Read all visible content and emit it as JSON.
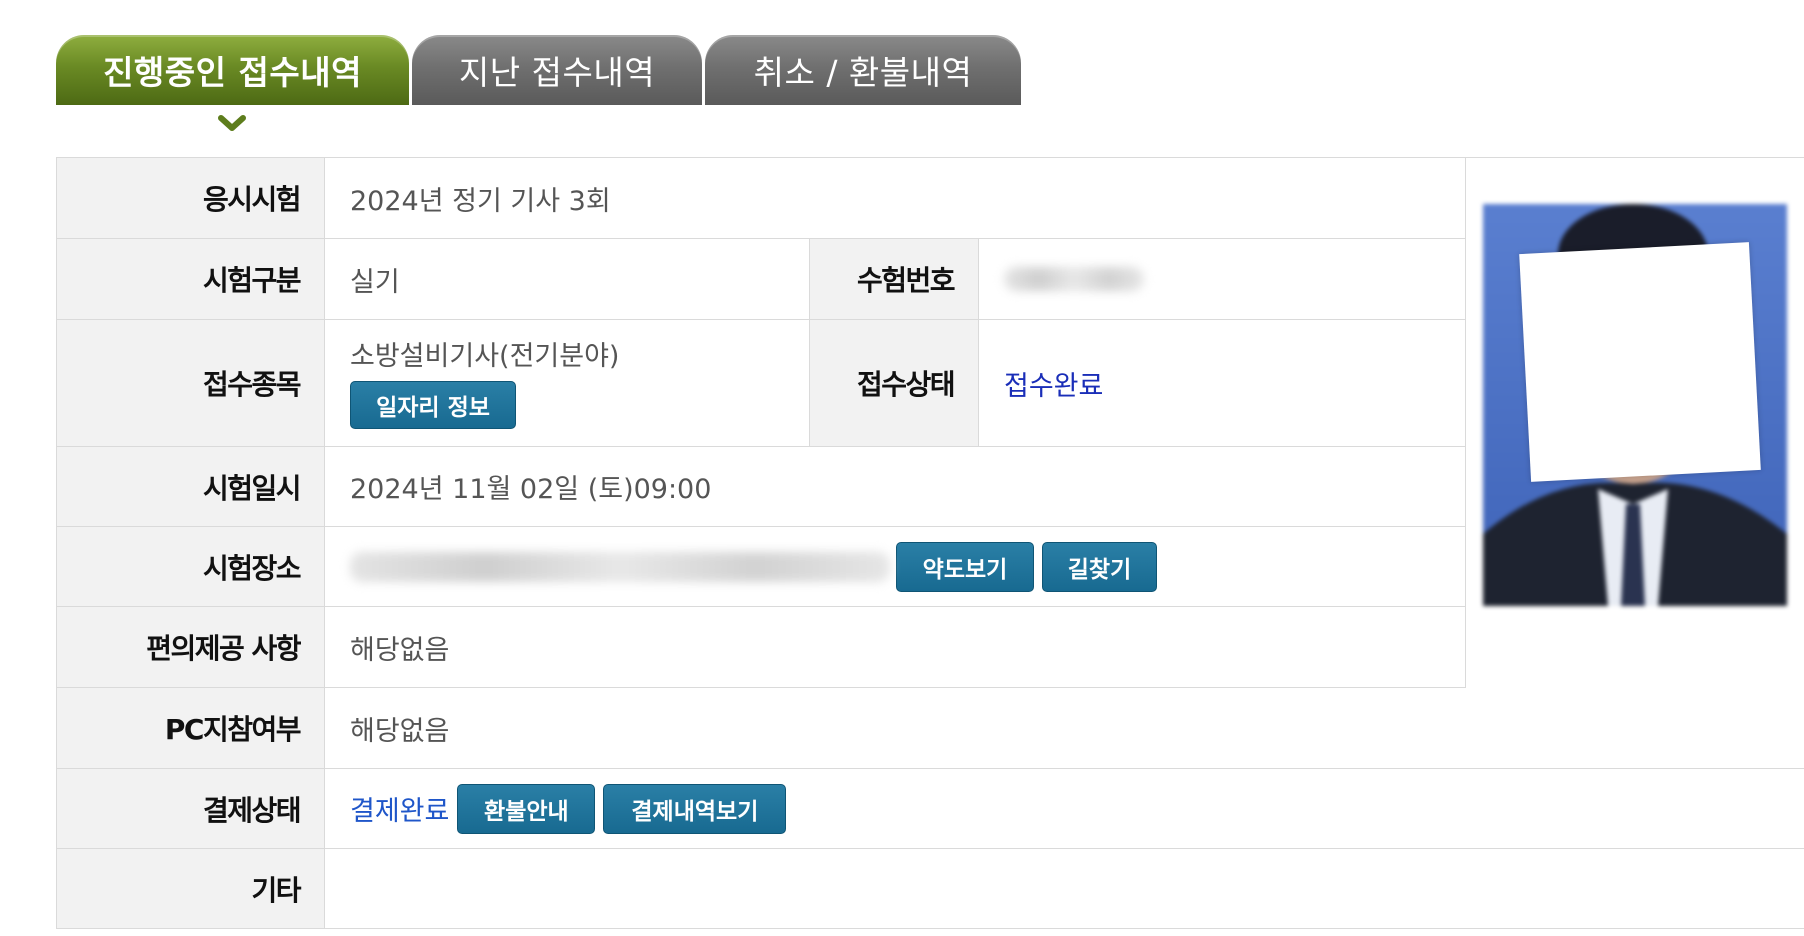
{
  "tabs": [
    {
      "label": "진행중인 접수내역",
      "active": true
    },
    {
      "label": "지난 접수내역",
      "active": false
    },
    {
      "label": "취소 / 환불내역",
      "active": false
    }
  ],
  "rows": {
    "exam": {
      "label": "응시시험",
      "value": "2024년 정기 기사 3회"
    },
    "division": {
      "label": "시험구분",
      "value": "실기"
    },
    "exam_number": {
      "label": "수험번호",
      "value": ""
    },
    "subject": {
      "label": "접수종목",
      "value": "소방설비기사(전기분야)",
      "button": "일자리 정보"
    },
    "status": {
      "label": "접수상태",
      "value": "접수완료"
    },
    "datetime": {
      "label": "시험일시",
      "value": "2024년 11월 02일 (토)09:00"
    },
    "venue": {
      "label": "시험장소",
      "value": "",
      "map_button": "약도보기",
      "route_button": "길찾기"
    },
    "accommodation": {
      "label": "편의제공 사항",
      "value": "해당없음"
    },
    "pc": {
      "label": "PC지참여부",
      "value": "해당없음"
    },
    "payment": {
      "label": "결제상태",
      "value": "결제완료",
      "refund_button": "환불안내",
      "history_button": "결제내역보기"
    },
    "etc": {
      "label": "기타",
      "value": ""
    }
  },
  "colors": {
    "active_tab": "#6a8a24",
    "inactive_tab": "#707070",
    "button": "#186a91",
    "status_link": "#1a2eb8",
    "payment_link": "#1f56c9"
  }
}
